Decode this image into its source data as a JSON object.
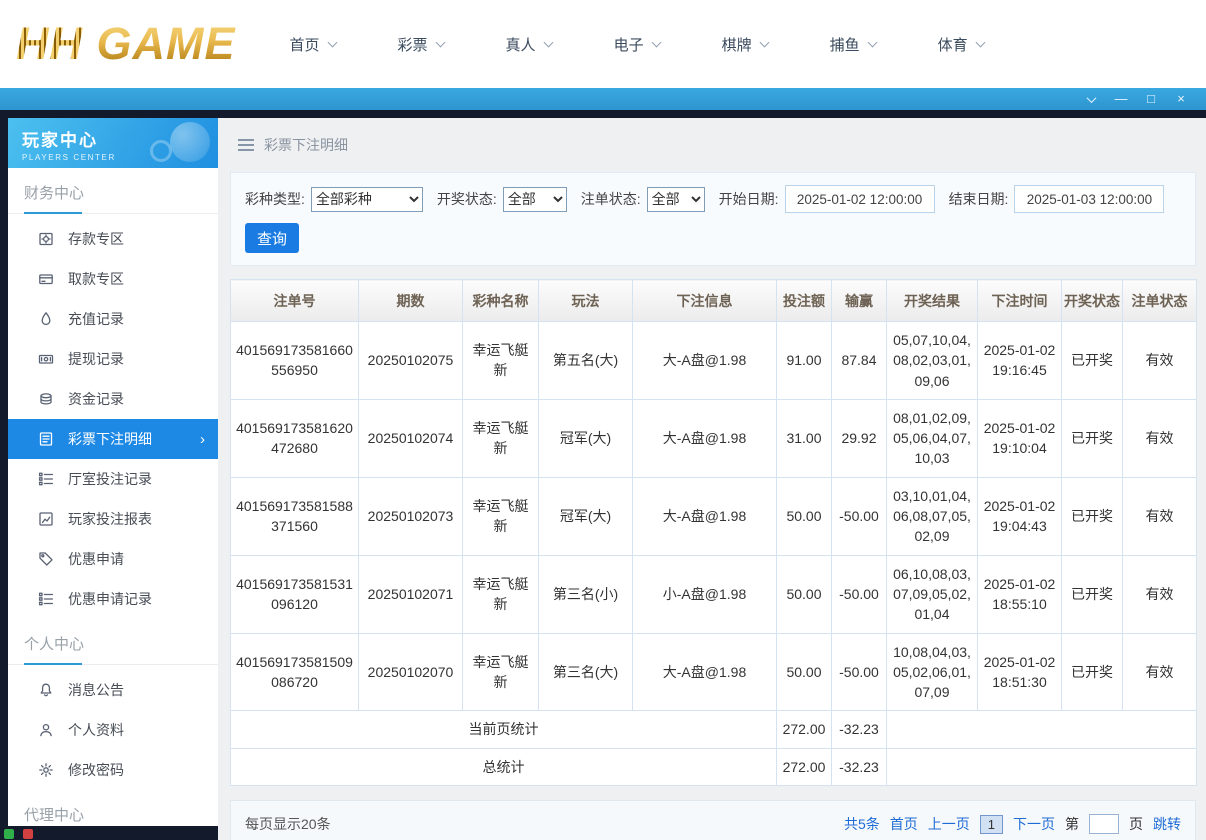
{
  "colors": {
    "accent": "#1e88e5",
    "titlebar": "#2f9fd8",
    "logo_gold": "#d8a63e"
  },
  "logo": {
    "text_primary": "HH",
    "text_secondary": " GAME"
  },
  "top_nav": {
    "items": [
      {
        "label": "首页"
      },
      {
        "label": "彩票"
      },
      {
        "label": "真人"
      },
      {
        "label": "电子"
      },
      {
        "label": "棋牌"
      },
      {
        "label": "捕鱼"
      },
      {
        "label": "体育"
      }
    ]
  },
  "window_controls": {
    "minimize": "—",
    "maximize": "□",
    "close": "×"
  },
  "sidebar": {
    "title": "玩家中心",
    "subtitle": "PLAYERS CENTER",
    "finance": {
      "heading": "财务中心",
      "items": [
        {
          "label": "存款专区"
        },
        {
          "label": "取款专区"
        },
        {
          "label": "充值记录"
        },
        {
          "label": "提现记录"
        },
        {
          "label": "资金记录"
        },
        {
          "label": "彩票下注明细"
        },
        {
          "label": "厅室投注记录"
        },
        {
          "label": "玩家投注报表"
        },
        {
          "label": "优惠申请"
        },
        {
          "label": "优惠申请记录"
        }
      ]
    },
    "personal": {
      "heading": "个人中心",
      "items": [
        {
          "label": "消息公告"
        },
        {
          "label": "个人资料"
        },
        {
          "label": "修改密码"
        }
      ]
    },
    "agent": {
      "heading": "代理中心"
    }
  },
  "breadcrumb": {
    "title": "彩票下注明细"
  },
  "filters": {
    "lottery_type_label": "彩种类型:",
    "lottery_type_value": "全部彩种",
    "draw_status_label": "开奖状态:",
    "draw_status_value": "全部",
    "order_status_label": "注单状态:",
    "order_status_value": "全部",
    "start_date_label": "开始日期:",
    "start_date_value": "2025-01-02 12:00:00",
    "end_date_label": "结束日期:",
    "end_date_value": "2025-01-03 12:00:00",
    "search_button": "查询"
  },
  "table": {
    "headers": [
      "注单号",
      "期数",
      "彩种名称",
      "玩法",
      "下注信息",
      "投注额",
      "输赢",
      "开奖结果",
      "下注时间",
      "开奖状态",
      "注单状态"
    ],
    "rows": [
      {
        "order_no": "401569173581660556950",
        "issue": "20250102075",
        "lottery": "幸运飞艇新",
        "play": "第五名(大)",
        "bet_info": "大-A盘@1.98",
        "amount": "91.00",
        "win_loss": "87.84",
        "result": "05,07,10,04,08,02,03,01,09,06",
        "bet_time": "2025-01-02 19:16:45",
        "draw_status": "已开奖",
        "order_status": "有效"
      },
      {
        "order_no": "401569173581620472680",
        "issue": "20250102074",
        "lottery": "幸运飞艇新",
        "play": "冠军(大)",
        "bet_info": "大-A盘@1.98",
        "amount": "31.00",
        "win_loss": "29.92",
        "result": "08,01,02,09,05,06,04,07,10,03",
        "bet_time": "2025-01-02 19:10:04",
        "draw_status": "已开奖",
        "order_status": "有效"
      },
      {
        "order_no": "401569173581588371560",
        "issue": "20250102073",
        "lottery": "幸运飞艇新",
        "play": "冠军(大)",
        "bet_info": "大-A盘@1.98",
        "amount": "50.00",
        "win_loss": "-50.00",
        "result": "03,10,01,04,06,08,07,05,02,09",
        "bet_time": "2025-01-02 19:04:43",
        "draw_status": "已开奖",
        "order_status": "有效"
      },
      {
        "order_no": "401569173581531096120",
        "issue": "20250102071",
        "lottery": "幸运飞艇新",
        "play": "第三名(小)",
        "bet_info": "小-A盘@1.98",
        "amount": "50.00",
        "win_loss": "-50.00",
        "result": "06,10,08,03,07,09,05,02,01,04",
        "bet_time": "2025-01-02 18:55:10",
        "draw_status": "已开奖",
        "order_status": "有效"
      },
      {
        "order_no": "401569173581509086720",
        "issue": "20250102070",
        "lottery": "幸运飞艇新",
        "play": "第三名(大)",
        "bet_info": "大-A盘@1.98",
        "amount": "50.00",
        "win_loss": "-50.00",
        "result": "10,08,04,03,05,02,06,01,07,09",
        "bet_time": "2025-01-02 18:51:30",
        "draw_status": "已开奖",
        "order_status": "有效"
      }
    ],
    "summary_current": {
      "label": "当前页统计",
      "amount": "272.00",
      "win_loss": "-32.23"
    },
    "summary_total": {
      "label": "总统计",
      "amount": "272.00",
      "win_loss": "-32.23"
    }
  },
  "pagination": {
    "per_page_text": "每页显示20条",
    "total_text": "共5条",
    "first": "首页",
    "prev": "上一页",
    "current_page": "1",
    "next": "下一页",
    "jump_prefix": "第",
    "jump_suffix": "页",
    "jump_button": "跳转",
    "jump_input_value": ""
  }
}
